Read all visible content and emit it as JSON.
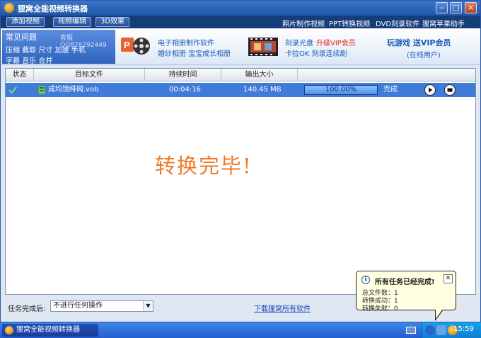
{
  "window": {
    "title": "狸窝全能视频转换器"
  },
  "toolbar": {
    "buttons": [
      "添加视频",
      "视频编辑",
      "3D效果"
    ],
    "links": [
      "照片制作视频",
      "PPT转换视频",
      "DVD刻录软件",
      "狸窝苹果助手"
    ]
  },
  "promo": {
    "faq_title": "常见问题",
    "faq_service": "客服QQ876292449",
    "faq_links1": "压缩 截取 尺寸 加速 手机",
    "faq_links2": "字幕 音乐 合并",
    "ppt_line1": "电子相册制作软件",
    "ppt_line2": "婚纱相册 宝宝成长相册",
    "dvd_line1": "刻录光盘",
    "dvd_vip": "升级VIP会员",
    "dvd_line2": "卡拉OK 刻录连续剧",
    "game_line1": "玩游戏 送VIP会员",
    "game_line2": "(在线用户)"
  },
  "table": {
    "headers": [
      "状态",
      "目标文件",
      "持续时间",
      "输出大小"
    ],
    "rows": [
      {
        "file": "成均馆绯闻.vob",
        "duration": "00:04:16",
        "size": "140.45 MB",
        "progress": 100,
        "progress_label": "100.00%",
        "status": "完成"
      }
    ]
  },
  "main": {
    "done_message": "转换完毕!"
  },
  "bottom": {
    "after_label": "任务完成后:",
    "after_option": "不进行任何操作",
    "download_link": "下载狸窝所有软件"
  },
  "balloon": {
    "title": "所有任务已经完成!",
    "lines": [
      "总文件数：1",
      "转换成功：1",
      "转换失败：0"
    ]
  },
  "taskbar": {
    "item": "狸窝全能视频转换器",
    "clock": "15:59"
  },
  "colors": {
    "accent": "#3f7bd8",
    "done_text": "#ef7a28",
    "vip_red": "#e02020"
  }
}
